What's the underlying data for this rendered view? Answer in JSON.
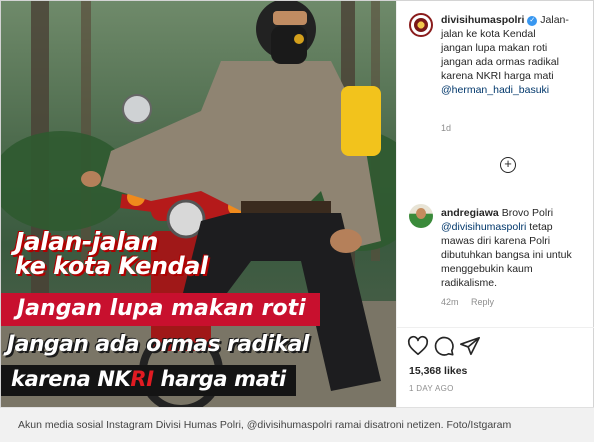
{
  "photo": {
    "overlay": {
      "line1": "Jalan-jalan",
      "line2": "ke kota Kendal",
      "line3": "Jangan lupa makan roti",
      "line4": "Jangan ada ormas radikal",
      "line5_pre": "karena NK",
      "line5_red": "RI",
      "line5_post": " harga mati"
    }
  },
  "post": {
    "username": "divisihumaspolri",
    "caption_first": "Jalan-jalan ke kota Kendal",
    "caption_lines": [
      "jangan lupa makan roti",
      "jangan ada ormas radikal",
      "karena NKRI harga mati"
    ],
    "mention": "@herman_hadi_basuki",
    "time": "1d",
    "load_more_symbol": "+"
  },
  "comment": {
    "username": "andregiawa",
    "text_first": "Brovo Polri",
    "mention": "@divisihumaspolri",
    "text_rest": "tetap mawas diri karena Polri dibutuhkan bangsa ini untuk menggebukin kaum radikalisme.",
    "time": "42m",
    "reply_label": "Reply"
  },
  "actions": {
    "icons": [
      "heart-icon",
      "comment-icon",
      "share-icon"
    ]
  },
  "likes": "15,368 likes",
  "posted_ago": "1 DAY AGO",
  "bottom_caption": "Akun media sosial Instagram Divisi Humas Polri, @divisihumaspolri ramai disatroni netizen. Foto/Istgaram",
  "colors": {
    "overlay_red": "#c8102e",
    "overlay_black": "#141414",
    "link_blue": "#00376b",
    "verified_blue": "#3897f0"
  }
}
